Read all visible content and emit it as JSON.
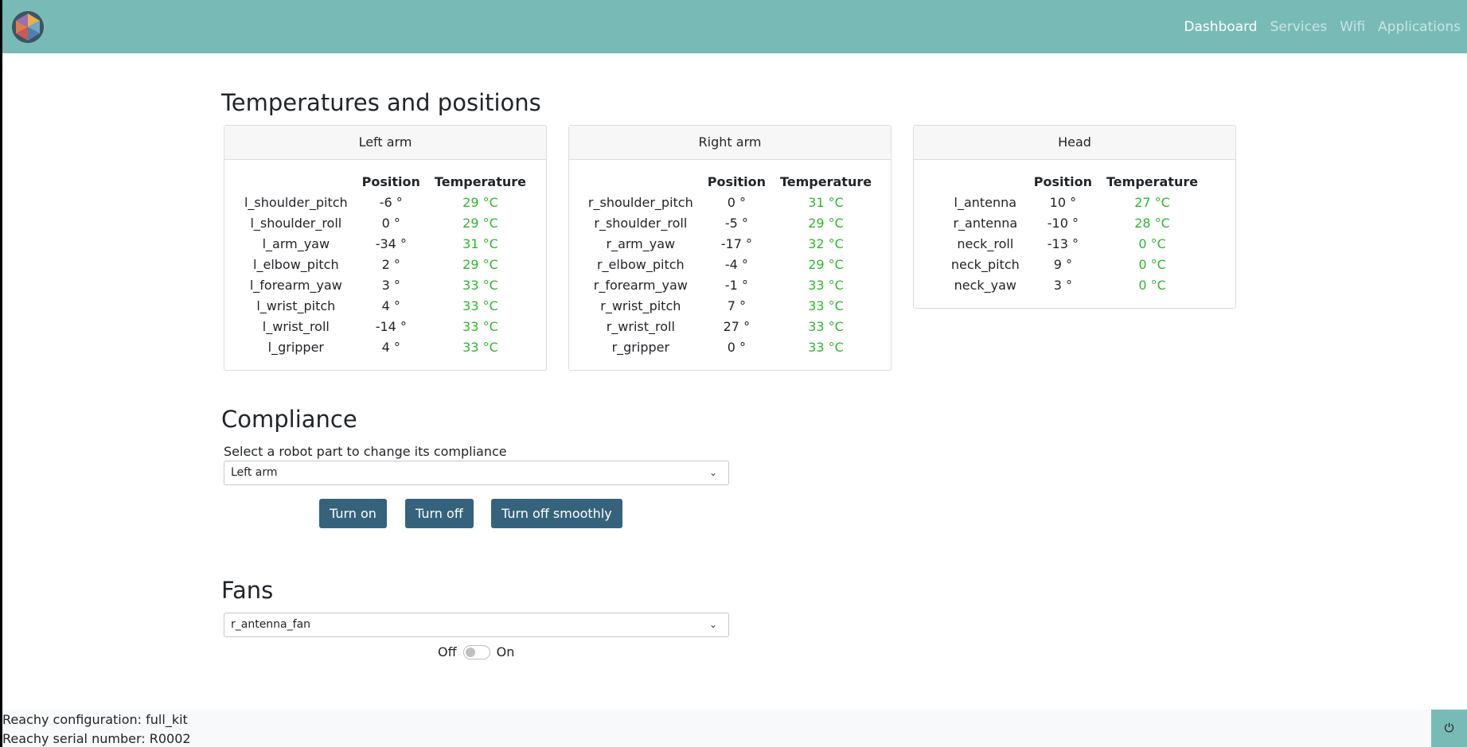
{
  "nav": {
    "items": [
      {
        "label": "Dashboard",
        "active": true
      },
      {
        "label": "Services",
        "active": false
      },
      {
        "label": "Wifi",
        "active": false
      },
      {
        "label": "Applications",
        "active": false
      }
    ]
  },
  "temps_section": {
    "title": "Temperatures and positions",
    "headers": {
      "position": "Position",
      "temperature": "Temperature"
    },
    "cards": [
      {
        "title": "Left arm",
        "rows": [
          {
            "joint": "l_shoulder_pitch",
            "position": "-6 °",
            "temperature": "29 °C"
          },
          {
            "joint": "l_shoulder_roll",
            "position": "0 °",
            "temperature": "29 °C"
          },
          {
            "joint": "l_arm_yaw",
            "position": "-34 °",
            "temperature": "31 °C"
          },
          {
            "joint": "l_elbow_pitch",
            "position": "2 °",
            "temperature": "29 °C"
          },
          {
            "joint": "l_forearm_yaw",
            "position": "3 °",
            "temperature": "33 °C"
          },
          {
            "joint": "l_wrist_pitch",
            "position": "4 °",
            "temperature": "33 °C"
          },
          {
            "joint": "l_wrist_roll",
            "position": "-14 °",
            "temperature": "33 °C"
          },
          {
            "joint": "l_gripper",
            "position": "4 °",
            "temperature": "33 °C"
          }
        ]
      },
      {
        "title": "Right arm",
        "rows": [
          {
            "joint": "r_shoulder_pitch",
            "position": "0 °",
            "temperature": "31 °C"
          },
          {
            "joint": "r_shoulder_roll",
            "position": "-5 °",
            "temperature": "29 °C"
          },
          {
            "joint": "r_arm_yaw",
            "position": "-17 °",
            "temperature": "32 °C"
          },
          {
            "joint": "r_elbow_pitch",
            "position": "-4 °",
            "temperature": "29 °C"
          },
          {
            "joint": "r_forearm_yaw",
            "position": "-1 °",
            "temperature": "33 °C"
          },
          {
            "joint": "r_wrist_pitch",
            "position": "7 °",
            "temperature": "33 °C"
          },
          {
            "joint": "r_wrist_roll",
            "position": "27 °",
            "temperature": "33 °C"
          },
          {
            "joint": "r_gripper",
            "position": "0 °",
            "temperature": "33 °C"
          }
        ]
      },
      {
        "title": "Head",
        "rows": [
          {
            "joint": "l_antenna",
            "position": "10 °",
            "temperature": "27 °C"
          },
          {
            "joint": "r_antenna",
            "position": "-10 °",
            "temperature": "28 °C"
          },
          {
            "joint": "neck_roll",
            "position": "-13 °",
            "temperature": "0 °C"
          },
          {
            "joint": "neck_pitch",
            "position": "9 °",
            "temperature": "0 °C"
          },
          {
            "joint": "neck_yaw",
            "position": "3 °",
            "temperature": "0 °C"
          }
        ]
      }
    ]
  },
  "compliance": {
    "title": "Compliance",
    "label": "Select a robot part to change its compliance",
    "selected": "Left arm",
    "buttons": {
      "on": "Turn on",
      "off": "Turn off",
      "smooth": "Turn off smoothly"
    }
  },
  "fans": {
    "title": "Fans",
    "selected": "r_antenna_fan",
    "off_label": "Off",
    "on_label": "On",
    "switch_on": false
  },
  "footer": {
    "configuration": "Reachy configuration: full_kit",
    "serial": "Reachy serial number: R0002",
    "power_icon": "⏻"
  },
  "colors": {
    "navbar": "#78bbb6",
    "button": "#35637d",
    "temperature_ok": "#2db82d"
  }
}
